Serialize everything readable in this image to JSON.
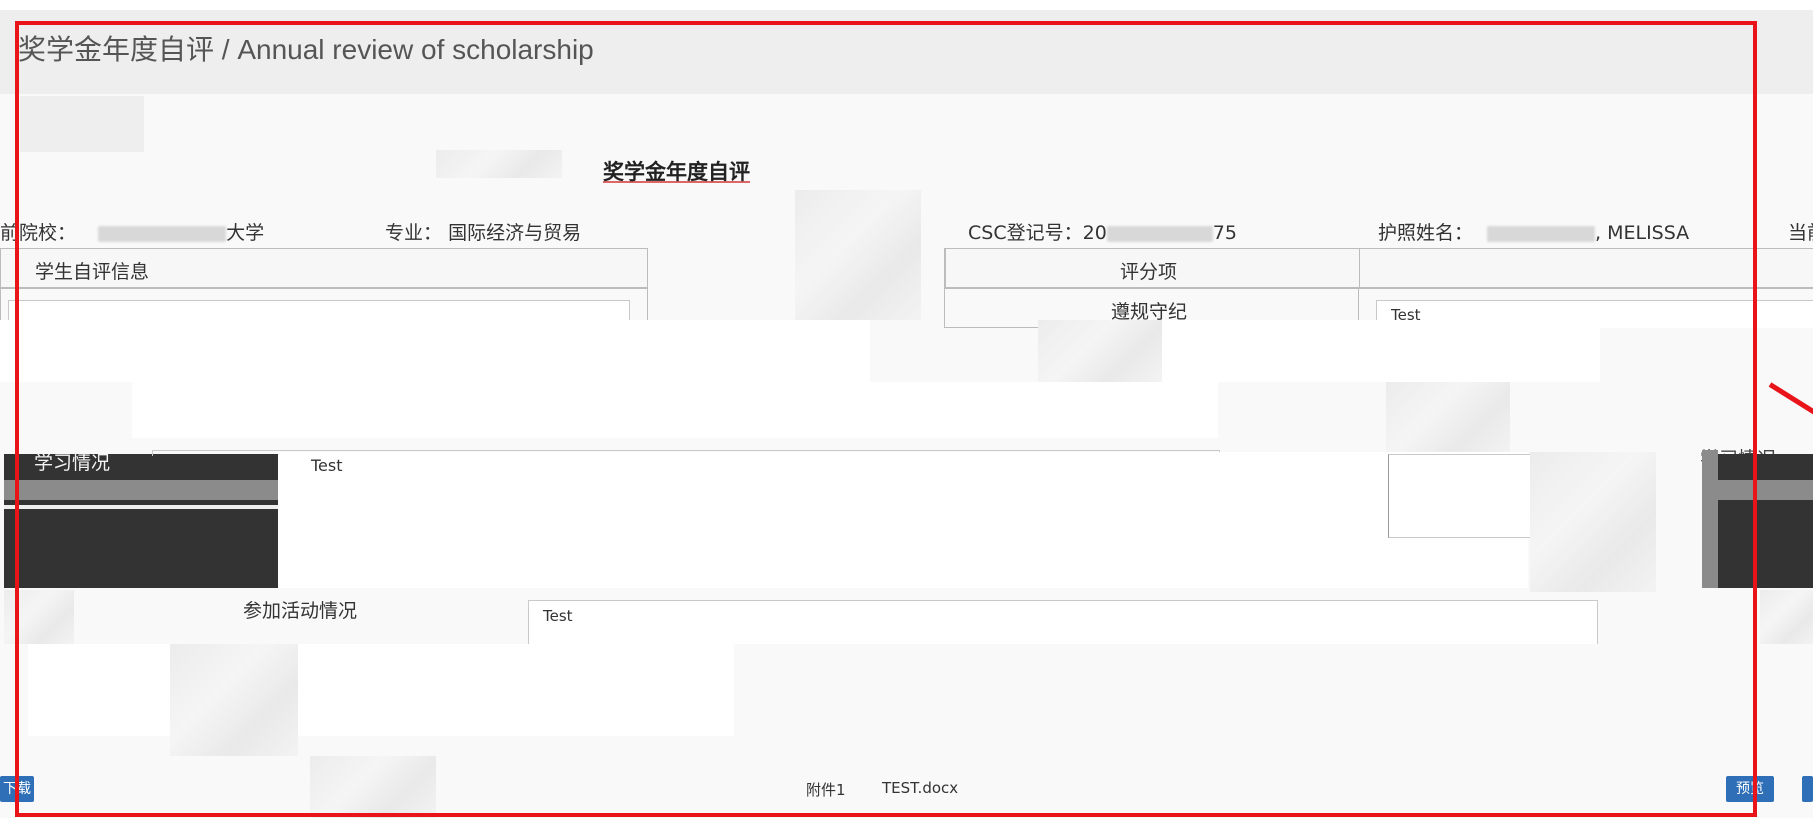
{
  "page": {
    "title": "奖学金年度自评 / Annual review of scholarship"
  },
  "form": {
    "title": "奖学金年度自评",
    "info": {
      "school_label": "前院校：",
      "school_value_suffix": "大学",
      "major_label": "专业：",
      "major_value": "国际经济与贸易",
      "csc_label": "CSC登记号：",
      "csc_value_prefix": "20",
      "csc_value_suffix": "75",
      "passport_label": "护照姓名：",
      "passport_value_suffix": ", MELISSA",
      "current_label": "当前"
    },
    "left_table": {
      "header": "学生自评信息"
    },
    "right_table": {
      "col_header": "评分项",
      "row1_label": "遵规守纪",
      "row1_value": "Test"
    },
    "study_label_right": "学习情况",
    "study_label_left": "学习情况",
    "study_value": "Test",
    "activity_label": "参加活动情况",
    "activity_value": "Test"
  },
  "attachments": {
    "label": "附件1",
    "filename": "TEST.docx",
    "download_button": "下载",
    "preview_button": "预览"
  },
  "colors": {
    "annotation_red": "#e8141a",
    "button_blue": "#2e6fb7"
  }
}
